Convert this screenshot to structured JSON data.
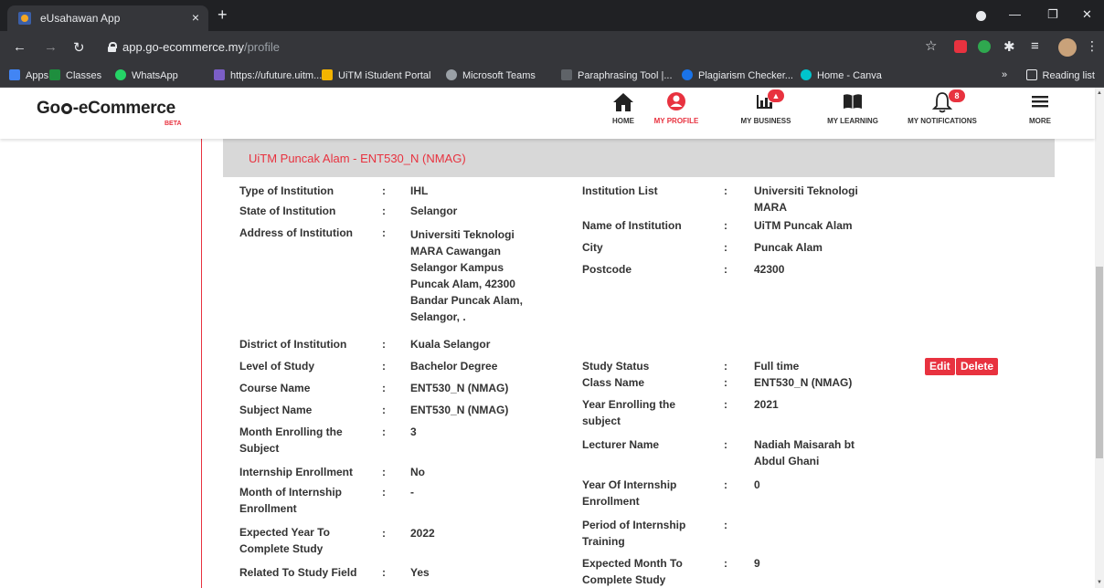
{
  "browser": {
    "tab_title": "eUsahawan App",
    "tab_close": "×",
    "new_tab": "+",
    "url_host": "app.go-ecommerce.my",
    "url_path": "/profile",
    "bookmarks": [
      "Apps",
      "Classes",
      "WhatsApp",
      "https://ufuture.uitm...",
      "UiTM iStudent Portal",
      "Microsoft Teams",
      "Paraphrasing Tool |...",
      "Plagiarism Checker...",
      "Home - Canva"
    ],
    "bookmarks_overflow": "»",
    "reading_list": "Reading list"
  },
  "app": {
    "logo": "Go-eCommerce",
    "beta": "BETA",
    "nav": [
      {
        "label": "HOME",
        "icon": "home-icon"
      },
      {
        "label": "MY PROFILE",
        "icon": "profile-icon"
      },
      {
        "label": "MY BUSINESS",
        "icon": "chart-icon"
      },
      {
        "label": "MY LEARNING",
        "icon": "book-icon"
      },
      {
        "label": "MY NOTIFICATIONS",
        "icon": "bell-icon",
        "badge": "8"
      },
      {
        "label": "MORE",
        "icon": "menu-icon"
      }
    ]
  },
  "panel": {
    "title": "UiTM Puncak Alam - ENT530_N (NMAG)"
  },
  "left_fields": [
    {
      "label": "Type of Institution",
      "value": "IHL"
    },
    {
      "label": "State of Institution",
      "value": "Selangor"
    },
    {
      "label": "Address of Institution",
      "value": "Universiti Teknologi MARA Cawangan Selangor Kampus Puncak Alam, 42300 Bandar Puncak Alam, Selangor, ."
    },
    {
      "label": "District of Institution",
      "value": "Kuala Selangor"
    },
    {
      "label": "Level of Study",
      "value": "Bachelor Degree"
    },
    {
      "label": "Course Name",
      "value": "ENT530_N (NMAG)"
    },
    {
      "label": "Subject Name",
      "value": "ENT530_N (NMAG)"
    },
    {
      "label": "Month Enrolling the Subject",
      "value": "3"
    },
    {
      "label": "Internship Enrollment",
      "value": "No"
    },
    {
      "label": "Month of Internship Enrollment",
      "value": "-"
    },
    {
      "label": "Expected Year To Complete Study",
      "value": "2022"
    },
    {
      "label": "Related To Study Field",
      "value": "Yes"
    }
  ],
  "right_fields": [
    {
      "label": "Institution List",
      "value": "Universiti Teknologi MARA"
    },
    {
      "label": "Name of Institution",
      "value": "UiTM Puncak Alam"
    },
    {
      "label": "City",
      "value": "Puncak Alam"
    },
    {
      "label": "Postcode",
      "value": "42300"
    },
    {
      "label": "Study Status",
      "value": "Full time"
    },
    {
      "label": "Class Name",
      "value": "ENT530_N (NMAG)"
    },
    {
      "label": "Year Enrolling the subject",
      "value": "2021"
    },
    {
      "label": "Lecturer Name",
      "value": "Nadiah Maisarah bt Abdul Ghani"
    },
    {
      "label": "Year Of Internship Enrollment",
      "value": "0"
    },
    {
      "label": "Period of Internship Training",
      "value": ""
    },
    {
      "label": "Expected Month To Complete Study",
      "value": "9"
    }
  ],
  "separator": ":",
  "actions": {
    "edit": "Edit",
    "delete": "Delete"
  }
}
